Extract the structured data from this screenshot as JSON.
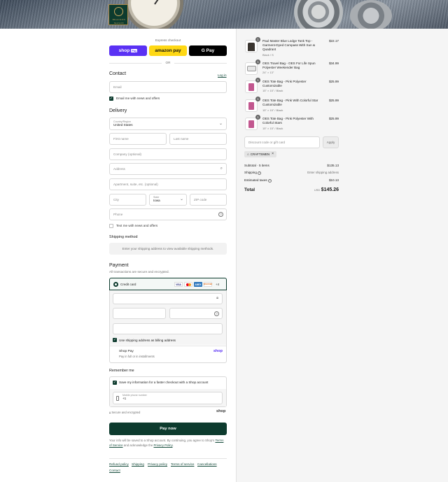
{
  "shop": {
    "logo_text_line1": "BRACKEN",
    "logo_text_line2": "MASON"
  },
  "express": {
    "title": "Express checkout",
    "shop_pay_label": "shop",
    "shop_pay_badge": "Pay",
    "amazon_pay_label": "amazon pay",
    "google_pay_label": "G Pay",
    "or_label": "OR"
  },
  "contact": {
    "heading": "Contact",
    "login_link": "Log in",
    "email_placeholder": "Email",
    "newsletter_label": "Email me with news and offers"
  },
  "delivery": {
    "heading": "Delivery",
    "country_label": "Country/Region",
    "country_value": "United States",
    "first_name_placeholder": "First name",
    "last_name_placeholder": "Last name",
    "company_placeholder": "Company (optional)",
    "address_placeholder": "Address",
    "apartment_placeholder": "Apartment, suite, etc. (optional)",
    "city_placeholder": "City",
    "state_label": "State",
    "state_value": "Iowa",
    "zip_placeholder": "ZIP code",
    "phone_placeholder": "Phone",
    "sms_label": "Text me with news and offers"
  },
  "shipping_method": {
    "heading": "Shipping method",
    "message": "Enter your shipping address to view available shipping methods."
  },
  "payment": {
    "heading": "Payment",
    "subtext": "All transactions are secure and encrypted.",
    "credit_card_label": "Credit card",
    "card_brands": [
      "VISA",
      "MC",
      "AMEX",
      "DISCOVER"
    ],
    "more_brands": "+4",
    "billing_label": "Use shipping address as billing address",
    "shop_pay_title": "Shop Pay",
    "shop_pay_sub": "Pay in full or in installments",
    "shop_pay_logo": "shop"
  },
  "remember": {
    "heading": "Remember me",
    "save_label": "Save my information for a faster checkout with a Shop account",
    "phone_label": "Mobile phone number",
    "phone_value": "+1",
    "secure_label": "Secure and encrypted",
    "shop_logo": "shop"
  },
  "pay_now_label": "Pay now",
  "legal": {
    "text_before": "Your info will be saved to a Shop account. By continuing, you agree to Shop's",
    "terms_link": "Terms of Service",
    "text_middle": "and acknowledge the",
    "privacy_link": "Privacy Policy",
    "text_end": "."
  },
  "footer_links": [
    "Refund policy",
    "Shipping",
    "Privacy policy",
    "Terms of service",
    "Cancellations",
    "Contact"
  ],
  "order": {
    "items": [
      {
        "qty": "1",
        "title": "Paul Master Blue Lodge Tank Top - Garment-Dyed Compass With Sun & Quadrant",
        "variant": "Black / S",
        "price": "$22.17",
        "thumb_color": "#3a3530"
      },
      {
        "qty": "1",
        "title": "OES Travel Bag - OES For Life Spun Polyester Weekender Bag",
        "variant": "24\" × 13\"",
        "price": "$34.99",
        "thumb_color": "#e7e7e7"
      },
      {
        "qty": "1",
        "title": "OES Tote Bag - Pink Polyester Customizable",
        "variant": "15\" × 15\" / Black",
        "price": "$25.99",
        "thumb_color": "#c2578f"
      },
      {
        "qty": "1",
        "title": "OES Tote Bag - Pink With Colorful Star Customizable",
        "variant": "15\" × 15\" / Black",
        "price": "$25.99",
        "thumb_color": "#c2578f"
      },
      {
        "qty": "1",
        "title": "OES Tote Bag - Pink Polyester With Colorful Stars",
        "variant": "15\" × 15\" / Black",
        "price": "$25.99",
        "thumb_color": "#c2578f"
      }
    ],
    "discount_placeholder": "Discount code or gift card",
    "apply_label": "Apply",
    "discount_tag": "CRAFTSMEN",
    "subtotal_label": "Subtotal · 5 items",
    "subtotal_value": "$135.13",
    "shipping_label": "Shipping",
    "shipping_value": "Enter shipping address",
    "taxes_label": "Estimated taxes",
    "taxes_value": "$10.13",
    "total_label": "Total",
    "currency": "USD",
    "total_value": "$145.26"
  },
  "colors": {
    "primary": "#0d3b2e",
    "shop_pay": "#5a31f4",
    "amazon": "#ffd814",
    "link": "#1a4f3f"
  }
}
